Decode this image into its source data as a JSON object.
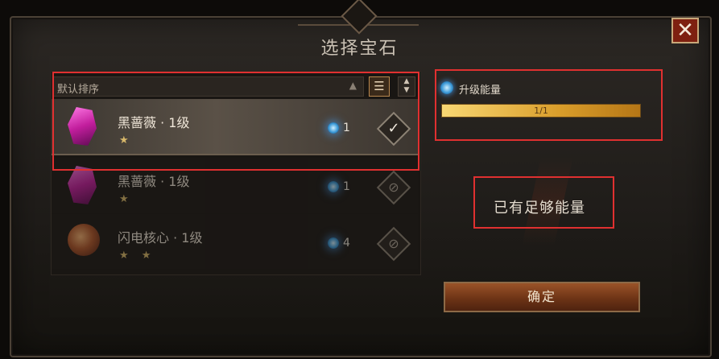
{
  "title": "选择宝石",
  "close_label": "✕",
  "sort": {
    "label": "默认排序",
    "arrow": "▲"
  },
  "list_toggle_icon": "☰",
  "order_toggle_icon": "▲\n▼",
  "gems": [
    {
      "name": "黑蔷薇 · 1级",
      "stars": "★",
      "energy": "1",
      "status": "✓",
      "icon": "pink-gem-icon"
    },
    {
      "name": "黑蔷薇 · 1级",
      "stars": "★",
      "energy": "1",
      "status": "⊘",
      "icon": "pink-gem-icon"
    },
    {
      "name": "闪电核心 · 1级",
      "stars": "★ ★",
      "energy": "4",
      "status": "⊘",
      "icon": "orange-orb-icon"
    }
  ],
  "energy": {
    "label": "升级能量",
    "value": "1/1",
    "fill_fraction": 1.0
  },
  "status_message": "已有足够能量",
  "confirm_label": "确定",
  "colors": {
    "highlight": "#e03030",
    "accent": "#d99d2a",
    "confirm": "#6e3416"
  }
}
